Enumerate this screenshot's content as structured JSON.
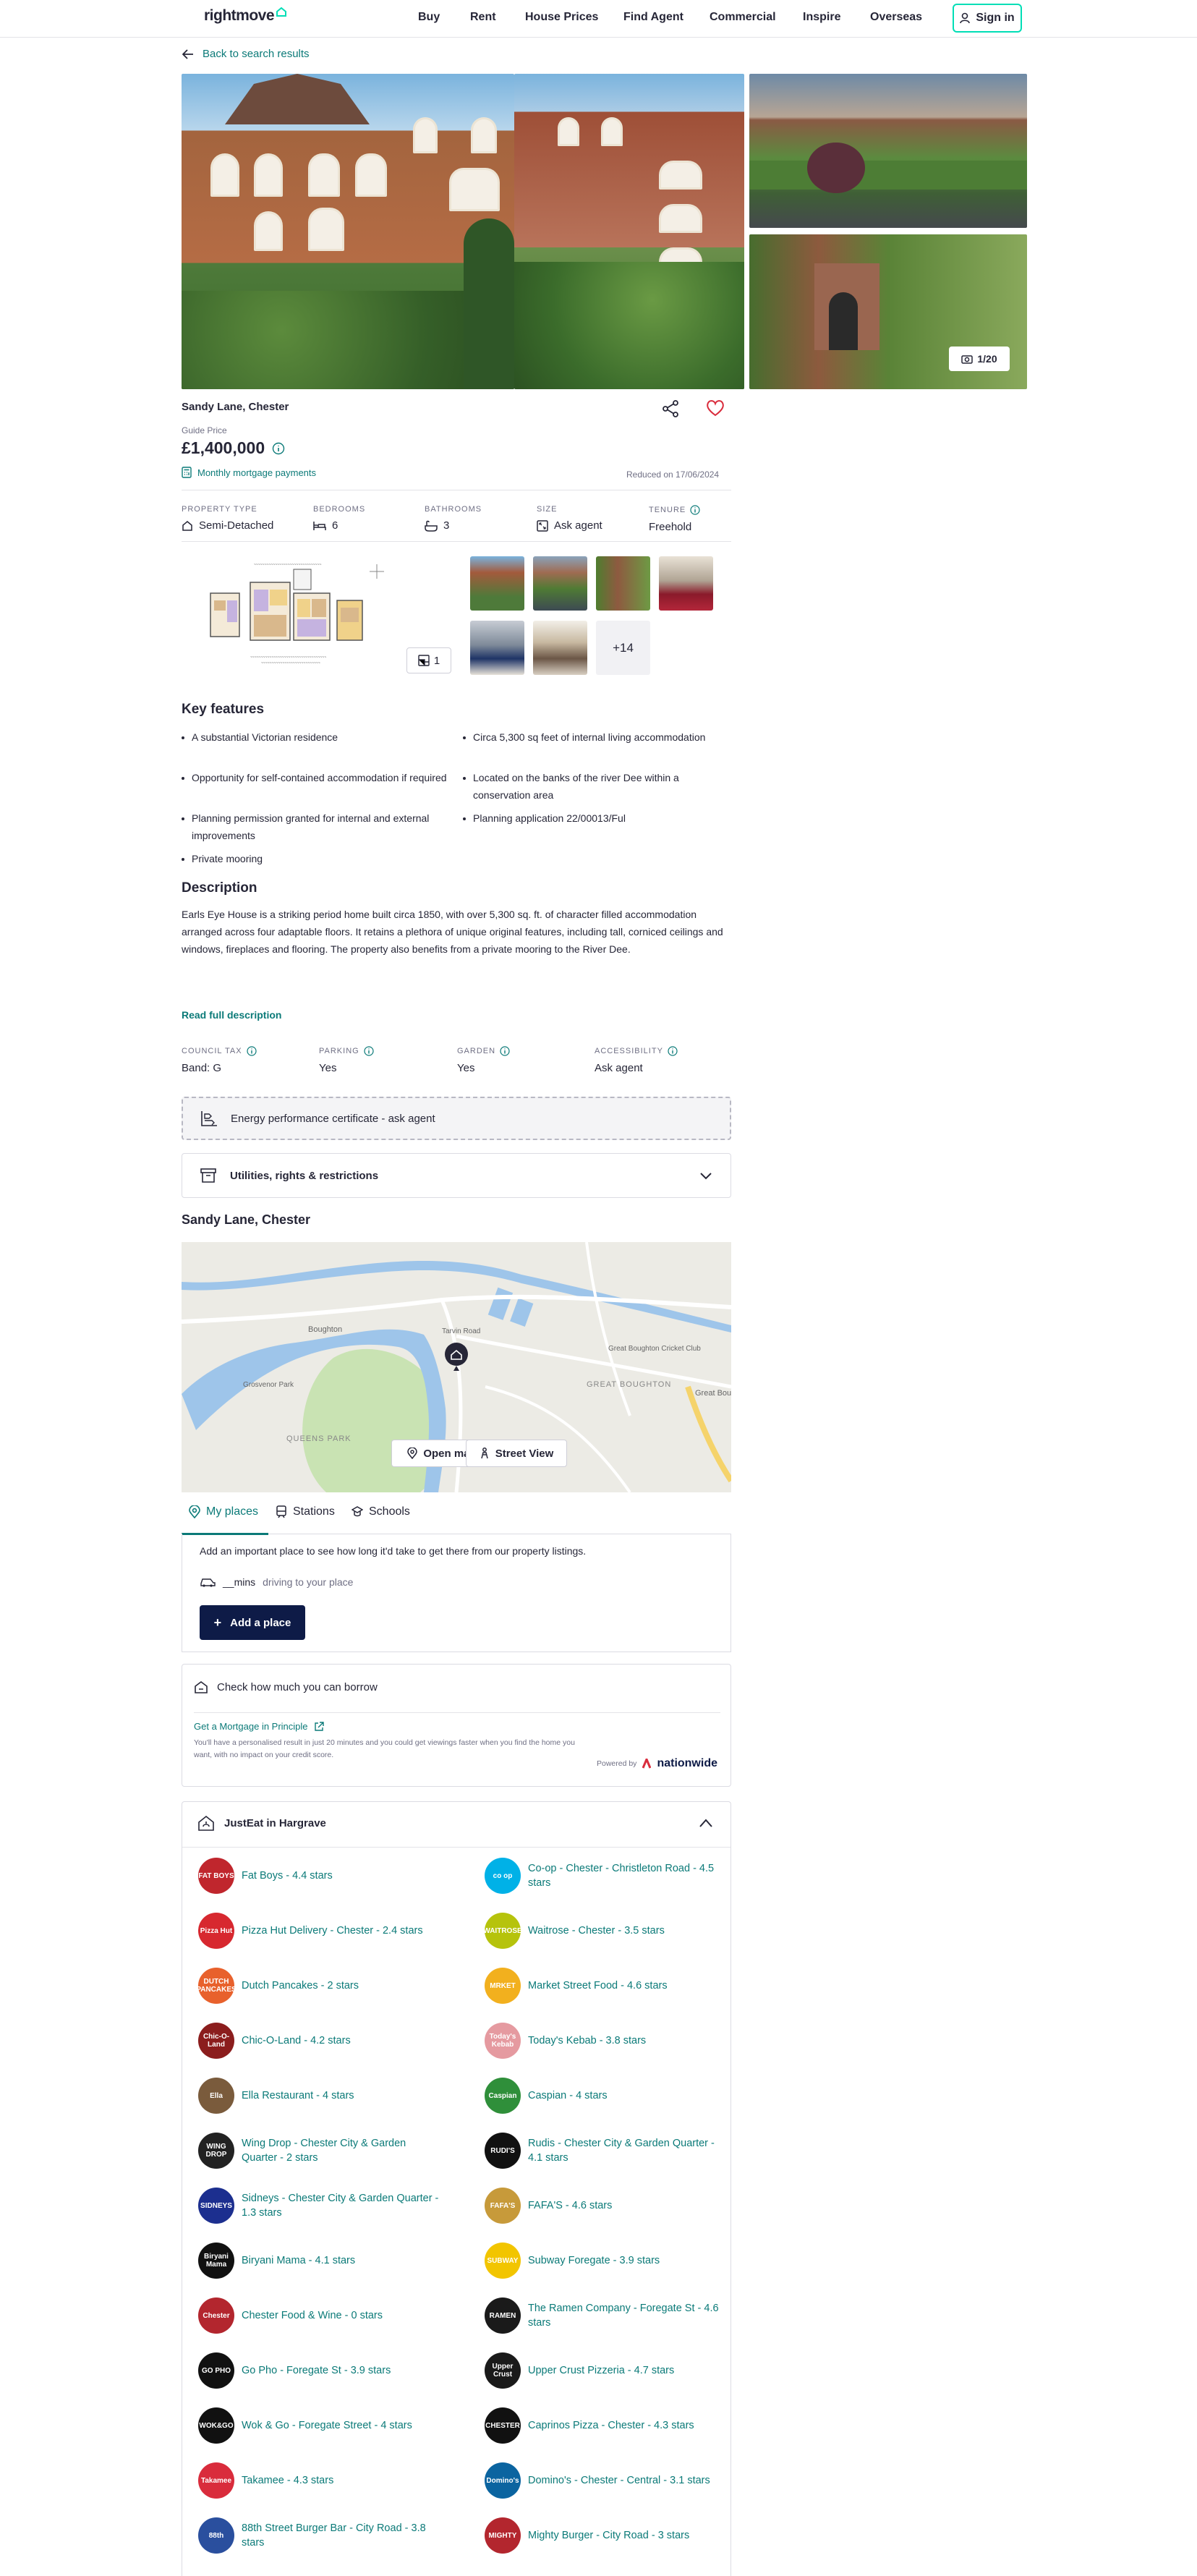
{
  "header": {
    "logo": "rightmove",
    "nav": [
      "Buy",
      "Rent",
      "House Prices",
      "Find Agent",
      "Commercial",
      "Inspire",
      "Overseas"
    ],
    "sign_in": "Sign in"
  },
  "back_link": "Back to search results",
  "gallery": {
    "counter": "1/20",
    "floorplan_count": "1",
    "more_photos": "+14"
  },
  "listing": {
    "address": "Sandy Lane, Chester",
    "price_qualifier": "Guide Price",
    "price": "£1,400,000",
    "mortgage_link": "Monthly mortgage payments",
    "reduced": "Reduced on 17/06/2024"
  },
  "specs": [
    {
      "key": "PROPERTY TYPE",
      "value": "Semi-Detached",
      "icon": "house-icon"
    },
    {
      "key": "BEDROOMS",
      "value": "6",
      "icon": "bed-icon"
    },
    {
      "key": "BATHROOMS",
      "value": "3",
      "icon": "bath-icon"
    },
    {
      "key": "SIZE",
      "value": "Ask agent",
      "icon": "size-icon"
    },
    {
      "key": "TENURE",
      "value": "Freehold",
      "icon": "info-icon"
    }
  ],
  "key_features": {
    "title": "Key features",
    "items": [
      "A substantial Victorian residence",
      "Circa 5,300 sq feet of internal living accommodation",
      "Opportunity for self-contained accommodation if required",
      "Located on the banks of the river Dee within a conservation area",
      "Planning permission granted for internal and external improvements",
      "Planning application 22/00013/Ful",
      "Private mooring"
    ]
  },
  "description": {
    "title": "Description",
    "text": "Earls Eye House is a striking period home built circa 1850, with over 5,300 sq. ft. of character filled accommodation arranged across four adaptable floors. It retains a plethora of unique original features, including tall, corniced ceilings and windows, fireplaces and flooring. The property also benefits from a private mooring to the River Dee.",
    "read_more": "Read full description"
  },
  "extra_info": [
    {
      "key": "COUNCIL TAX",
      "value": "Band: G"
    },
    {
      "key": "PARKING",
      "value": "Yes"
    },
    {
      "key": "GARDEN",
      "value": "Yes"
    },
    {
      "key": "ACCESSIBILITY",
      "value": "Ask agent"
    }
  ],
  "epc": "Energy performance certificate - ask agent",
  "utilities": "Utilities, rights & restrictions",
  "map": {
    "title": "Sandy Lane, Chester",
    "open_map": "Open map",
    "street_view": "Street View",
    "labels": [
      "Boughton",
      "Great Boughton Cricket Club",
      "GREAT BOUGHTON",
      "QUEENS PARK",
      "Grosvenor Park",
      "Tarvin Road",
      "Great Boug"
    ]
  },
  "places": {
    "tabs": [
      "My places",
      "Stations",
      "Schools"
    ],
    "prompt": "Add an important place to see how long it'd take to get there from our property listings.",
    "mins": "__mins",
    "driving": "driving to your place",
    "add_button": "Add a place"
  },
  "mortgage": {
    "title": "Check how much you can borrow",
    "link": "Get a Mortgage in Principle",
    "text": "You'll have a personalised result in just 20 minutes and you could get viewings faster when you find the home you want, with no impact on your credit score.",
    "powered": "Powered by",
    "brand": "nationwide"
  },
  "justeat": {
    "title": "JustEat in Hargrave",
    "restaurants": [
      {
        "name": "Fat Boys - 4.4 stars",
        "logo": "FAT BOYS",
        "color": "#c0262d"
      },
      {
        "name": "Co-op - Chester - Christleton Road - 4.5 stars",
        "logo": "co op",
        "color": "#00b1e7"
      },
      {
        "name": "Pizza Hut Delivery - Chester - 2.4 stars",
        "logo": "Pizza Hut",
        "color": "#d7282f"
      },
      {
        "name": "Waitrose - Chester - 3.5 stars",
        "logo": "WAITROSE",
        "color": "#b6c30c"
      },
      {
        "name": "Dutch Pancakes - 2 stars",
        "logo": "DUTCH PANCAKES",
        "color": "#e8612c"
      },
      {
        "name": "Market Street Food - 4.6 stars",
        "logo": "MRKET",
        "color": "#f2b01e"
      },
      {
        "name": "Chic-O-Land - 4.2 stars",
        "logo": "Chic-O-Land",
        "color": "#8b1d1d"
      },
      {
        "name": "Today's Kebab - 3.8 stars",
        "logo": "Today's Kebab",
        "color": "#e59aa0"
      },
      {
        "name": "Ella Restaurant - 4 stars",
        "logo": "Ella",
        "color": "#7a5b3c"
      },
      {
        "name": "Caspian - 4 stars",
        "logo": "Caspian",
        "color": "#2f8f3a"
      },
      {
        "name": "Wing Drop - Chester City & Garden Quarter - 2 stars",
        "logo": "WING DROP",
        "color": "#222222"
      },
      {
        "name": "Rudis - Chester City & Garden Quarter - 4.1 stars",
        "logo": "RUDI'S",
        "color": "#111111"
      },
      {
        "name": "Sidneys - Chester City & Garden Quarter - 1.3 stars",
        "logo": "SIDNEYS",
        "color": "#1c2f8f"
      },
      {
        "name": "FAFA'S - 4.6 stars",
        "logo": "FAFA'S",
        "color": "#c79a3a"
      },
      {
        "name": "Biryani Mama - 4.1 stars",
        "logo": "Biryani Mama",
        "color": "#111111"
      },
      {
        "name": "Subway Foregate - 3.9 stars",
        "logo": "SUBWAY",
        "color": "#f2c500"
      },
      {
        "name": "Chester Food & Wine - 0 stars",
        "logo": "Chester",
        "color": "#b3262e"
      },
      {
        "name": "The Ramen Company - Foregate St - 4.6 stars",
        "logo": "RAMEN",
        "color": "#1a1a1a"
      },
      {
        "name": "Go Pho - Foregate St - 3.9 stars",
        "logo": "GO PHO",
        "color": "#111111"
      },
      {
        "name": "Upper Crust Pizzeria - 4.7 stars",
        "logo": "Upper Crust",
        "color": "#1a1a1a"
      },
      {
        "name": "Wok & Go - Foregate Street - 4 stars",
        "logo": "WOK&GO",
        "color": "#111111"
      },
      {
        "name": "Caprinos Pizza - Chester - 4.3 stars",
        "logo": "CHESTER",
        "color": "#111111"
      },
      {
        "name": "Takamee - 4.3 stars",
        "logo": "Takamee",
        "color": "#d92c3c"
      },
      {
        "name": "Domino's - Chester - Central - 3.1 stars",
        "logo": "Domino's",
        "color": "#0b64a0"
      },
      {
        "name": "88th Street Burger Bar - City Road - 3.8 stars",
        "logo": "88th",
        "color": "#2a4f9e"
      },
      {
        "name": "Mighty Burger - City Road - 3 stars",
        "logo": "MIGHTY",
        "color": "#b3262e"
      }
    ]
  },
  "colors": {
    "accent": "#0b7a78",
    "brand_mint": "#00deb6",
    "navy": "#0e1b47",
    "heart": "#d92c3c"
  }
}
